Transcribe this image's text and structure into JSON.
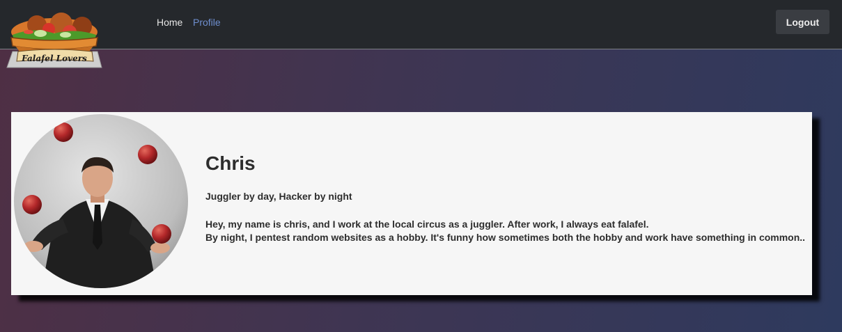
{
  "navbar": {
    "logo_text": "Falafel Lovers",
    "links": [
      {
        "label": "Home",
        "active": false
      },
      {
        "label": "Profile",
        "active": true
      }
    ],
    "logout_label": "Logout"
  },
  "profile": {
    "name": "Chris",
    "tagline": "Juggler by day, Hacker by night",
    "bio_lines": [
      "Hey, my name is chris, and I work at the local circus as a juggler. After work, I always eat falafel.",
      "By night, I pentest random websites as a hobby. It's funny how sometimes both the hobby and work have something in common.."
    ]
  },
  "colors": {
    "navbar_bg": "#25282c",
    "link_active": "#6f8fcf",
    "card_bg": "#f6f6f6"
  }
}
